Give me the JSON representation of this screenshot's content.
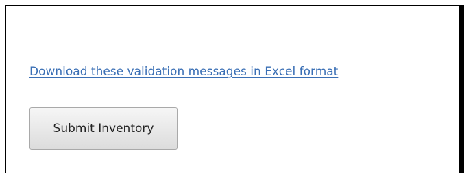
{
  "validation": {
    "download_link_label": "Download these validation messages in Excel format"
  },
  "actions": {
    "submit_label": "Submit Inventory"
  },
  "colors": {
    "link": "#3a6fb5",
    "frame_border": "#000000"
  }
}
